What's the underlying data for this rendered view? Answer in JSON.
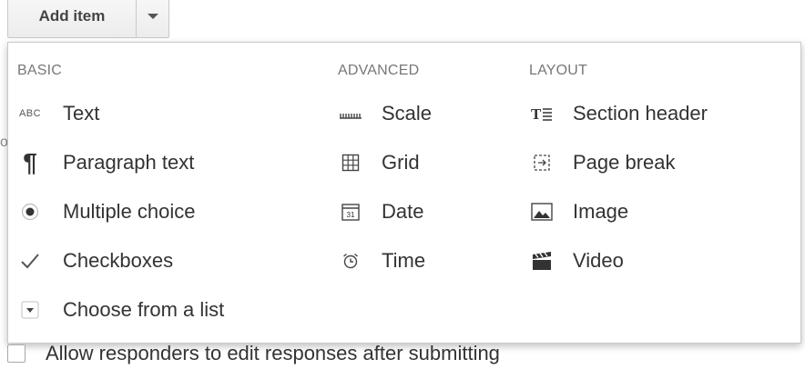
{
  "button": {
    "label": "Add item",
    "arrow_icon": "chevron-down-icon"
  },
  "menu": {
    "columns": [
      {
        "title": "BASIC",
        "items": [
          {
            "label": "Text",
            "icon": "abc-text-icon"
          },
          {
            "label": "Paragraph text",
            "icon": "pilcrow-icon"
          },
          {
            "label": "Multiple choice",
            "icon": "radio-icon"
          },
          {
            "label": "Checkboxes",
            "icon": "checkmark-icon"
          },
          {
            "label": "Choose from a list",
            "icon": "dropdown-icon"
          }
        ]
      },
      {
        "title": "ADVANCED",
        "items": [
          {
            "label": "Scale",
            "icon": "scale-icon"
          },
          {
            "label": "Grid",
            "icon": "grid-icon"
          },
          {
            "label": "Date",
            "icon": "calendar-icon"
          },
          {
            "label": "Time",
            "icon": "alarm-clock-icon"
          }
        ]
      },
      {
        "title": "LAYOUT",
        "items": [
          {
            "label": "Section header",
            "icon": "section-header-icon"
          },
          {
            "label": "Page break",
            "icon": "page-break-icon"
          },
          {
            "label": "Image",
            "icon": "image-icon"
          },
          {
            "label": "Video",
            "icon": "video-icon"
          }
        ]
      }
    ]
  },
  "settings": {
    "allow_edit_label": "Allow responders to edit responses after submitting"
  },
  "colors": {
    "menu_border": "#c9c9c9",
    "text": "#333333",
    "header": "#777777"
  }
}
